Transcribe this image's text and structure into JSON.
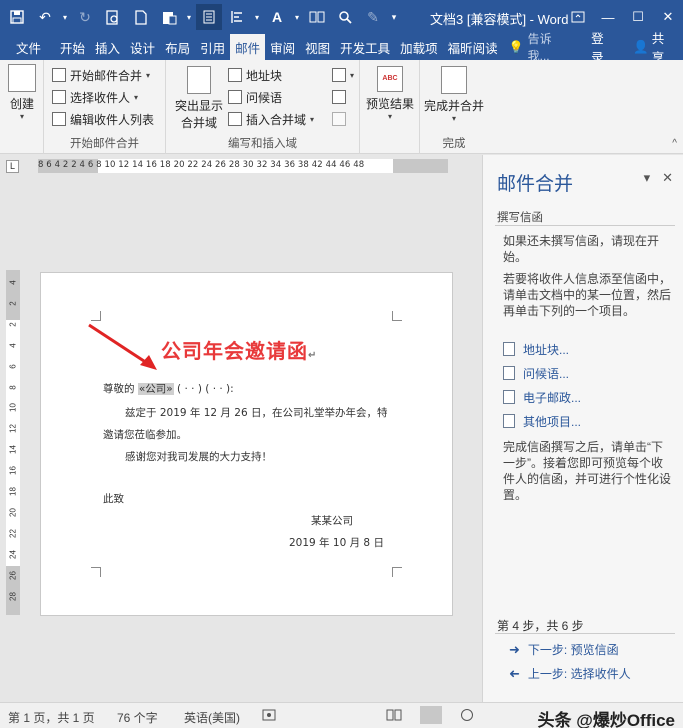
{
  "title_bar": {
    "document_title": "文档3 [兼容模式] - Word",
    "quick_access": [
      "save-icon",
      "undo-icon",
      "redo-icon",
      "print-preview-icon",
      "new-doc-icon",
      "paste-icon",
      "layout-icon",
      "align-icon",
      "font-color-icon",
      "more-icon",
      "find-icon",
      "format-painter-icon",
      "customize-icon"
    ]
  },
  "tabs": [
    "文件",
    "开始",
    "插入",
    "设计",
    "布局",
    "引用",
    "邮件",
    "审阅",
    "视图",
    "开发工具",
    "加载项",
    "福昕阅读"
  ],
  "active_tab": "邮件",
  "tell_me": "告诉我...",
  "login": "登录",
  "share": "共享",
  "ribbon": {
    "create": {
      "label": "创建",
      "group": ""
    },
    "start_merge": {
      "group": "开始邮件合并",
      "start": "开始邮件合并",
      "select": "选择收件人",
      "edit": "编辑收件人列表"
    },
    "write_insert": {
      "group": "编写和插入域",
      "highlight": "突出显示合并域",
      "highlight_line1": "突出显示",
      "highlight_line2": "合并域",
      "address": "地址块",
      "greeting": "问候语",
      "insert_field": "插入合并域"
    },
    "preview": {
      "label": "预览结果"
    },
    "finish": {
      "group": "完成",
      "label": "完成并合并"
    }
  },
  "ruler": {
    "numbers": "8   6   4   2      2   4   6   8   10  12  14  16  18  20  22  24  26  28  30  32  34  36  38     42  44  46  48"
  },
  "vruler": [
    "4",
    "2",
    "2",
    "4",
    "6",
    "8",
    "10",
    "12",
    "14",
    "16",
    "18",
    "20",
    "22",
    "24",
    "26",
    "28"
  ],
  "document": {
    "heading": "公司年会邀请函",
    "salutation_prefix": "尊敬的",
    "field_text": "«公司»",
    "salutation_rest": "( · · ) ( · · ):",
    "line1": "兹定于 2019 年 12 月 26 日，在公司礼堂举办年会，特",
    "line2": "邀请您莅临参加。",
    "line3": "感谢您对我司发展的大力支持！",
    "closing": "此致",
    "signature": "某某公司",
    "date": "2019 年 10 月 8 日"
  },
  "task_pane": {
    "title": "邮件合并",
    "section": "撰写信函",
    "intro": "如果还未撰写信函，请现在开始。",
    "instruction": "若要将收件人信息添至信函中，请单击文档中的某一位置，然后再单击下列的一个项目。",
    "links": [
      "地址块...",
      "问候语...",
      "电子邮政...",
      "其他项目..."
    ],
    "finish_text": "完成信函撰写之后，请单击“下一步”。接着您即可预览每个收件人的信函，并可进行个性化设置。",
    "step": "第 4 步，共 6 步",
    "next": "下一步: 预览信函",
    "prev": "上一步: 选择收件人"
  },
  "status_bar": {
    "page": "第 1 页，共 1 页",
    "words": "76 个字",
    "language": "英语(美国)",
    "watermark": "头条 @爆炒Office"
  },
  "colors": {
    "accent": "#2b579a",
    "heading_red": "#e8393a",
    "arrow_red": "#e02424"
  }
}
